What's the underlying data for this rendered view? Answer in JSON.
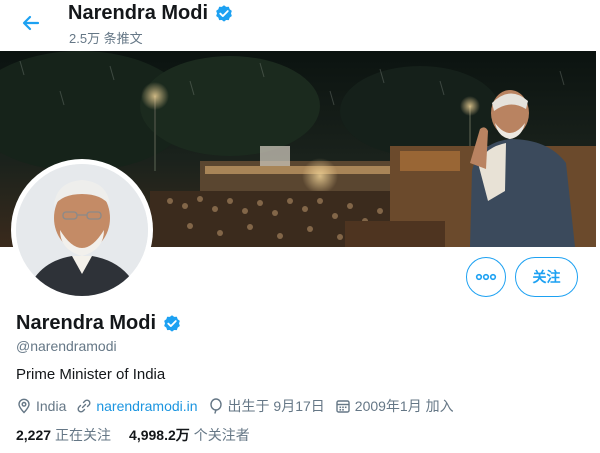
{
  "header": {
    "name": "Narendra Modi",
    "tweet_count": "2.5万 条推文"
  },
  "profile": {
    "name": "Narendra Modi",
    "handle": "@narendramodi",
    "bio": "Prime Minister of India",
    "location": "India",
    "website": "narendramodi.in",
    "birthday": "出生于 9月17日",
    "joined": "2009年1月 加入"
  },
  "actions": {
    "more_icon": "more-icon",
    "follow_label": "关注"
  },
  "stats": {
    "following_count": "2,227",
    "following_label": "正在关注",
    "followers_count": "4,998.2万",
    "followers_label": "个关注者"
  },
  "colors": {
    "accent": "#1da1f2",
    "link": "#1b95e0",
    "muted": "#657786",
    "text": "#14171a"
  }
}
